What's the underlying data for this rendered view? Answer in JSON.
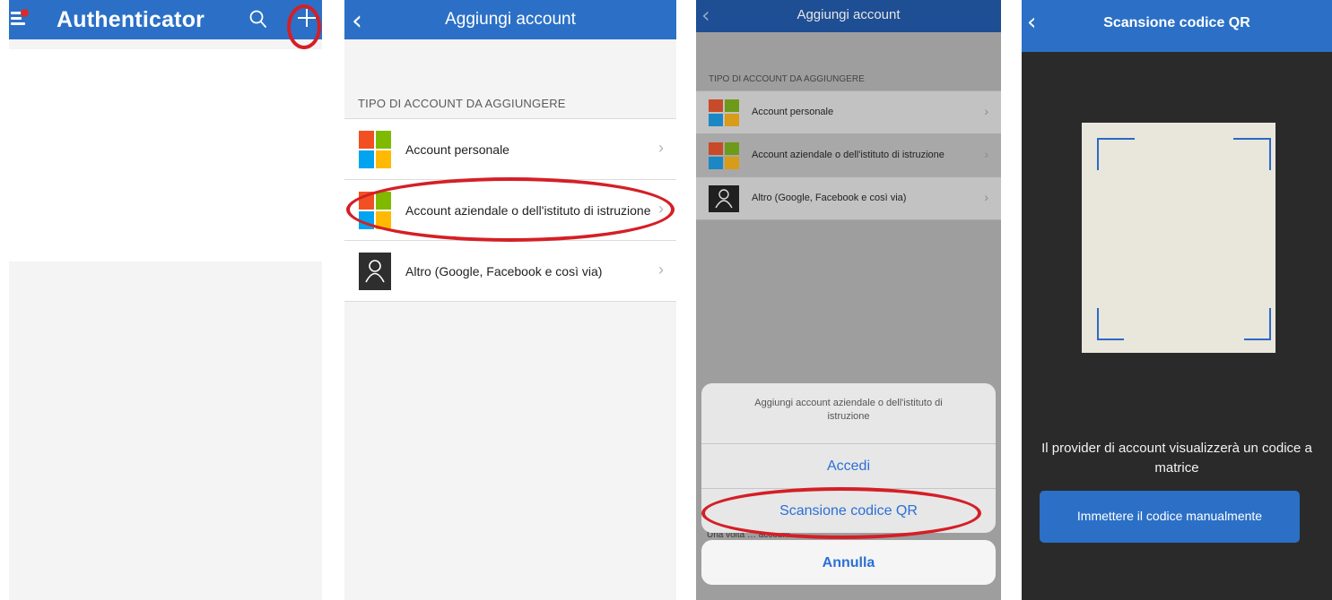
{
  "screen1": {
    "title": "Authenticator",
    "icons": [
      "hamburger-menu-icon",
      "search-icon",
      "plus-icon"
    ]
  },
  "screen2": {
    "title": "Aggiungi account",
    "section_header": "TIPO DI ACCOUNT DA AGGIUNGERE",
    "items": [
      {
        "label": "Account personale",
        "icon": "microsoft-logo-icon"
      },
      {
        "label": "Account aziendale o dell'istituto di istruzione",
        "icon": "microsoft-logo-icon"
      },
      {
        "label": "Altro (Google, Facebook e così via)",
        "icon": "person-icon"
      }
    ]
  },
  "screen3": {
    "title": "Aggiungi account",
    "section_header": "TIPO DI ACCOUNT DA AGGIUNGERE",
    "items": [
      {
        "label": "Account personale"
      },
      {
        "label": "Account aziendale o dell'istituto di istruzione"
      },
      {
        "label": "Altro (Google, Facebook e così via)"
      }
    ],
    "sheet_message": "Aggiungi account aziendale o dell'istituto di istruzione",
    "sheet_options": [
      "Accedi",
      "Scansione codice QR"
    ],
    "partially_hidden_text": "Una volta … account",
    "cancel_label": "Annulla"
  },
  "screen4": {
    "title": "Scansione codice QR",
    "caption": "Il provider di account visualizzerà un codice a matrice",
    "button_label": "Immettere il codice manualmente"
  },
  "colors": {
    "header_blue": "#2b70c6",
    "highlight_red": "#d41f26",
    "ios_link_blue": "#2b6fd6",
    "ms_red": "#f25022",
    "ms_green": "#7fba00",
    "ms_blue": "#00a4ef",
    "ms_yellow": "#ffb900"
  }
}
